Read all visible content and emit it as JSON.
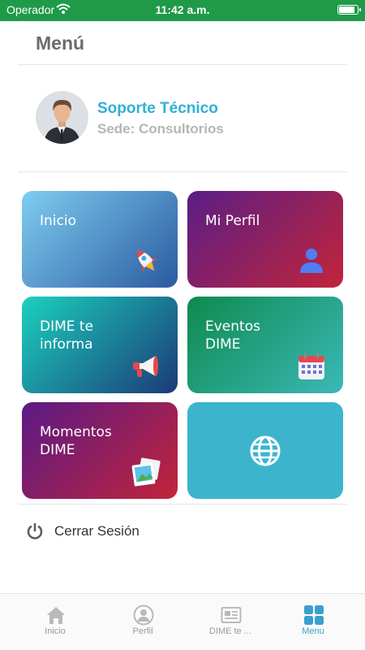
{
  "status_bar": {
    "carrier": "Operador",
    "time": "11:42 a.m.",
    "battery_level": 0.95
  },
  "header": {
    "title": "Menú"
  },
  "profile": {
    "name": "Soporte Técnico",
    "sede": "Sede: Consultorios"
  },
  "tiles": [
    {
      "label": "Inicio",
      "icon": "rocket-icon"
    },
    {
      "label": "Mi Perfil",
      "icon": "user-icon"
    },
    {
      "label": "DIME te\ninforma",
      "icon": "megaphone-icon"
    },
    {
      "label": "Eventos\nDIME",
      "icon": "calendar-icon"
    },
    {
      "label": "Momentos\nDIME",
      "icon": "photos-icon"
    },
    {
      "label": "",
      "icon": "globe-icon"
    }
  ],
  "logout": {
    "label": "Cerrar Sesión",
    "icon": "power-icon"
  },
  "tabbar": {
    "active": "Menu",
    "tabs": [
      {
        "label": "Inicio",
        "icon": "home-icon"
      },
      {
        "label": "Perfil",
        "icon": "profile-icon"
      },
      {
        "label": "DIME te ...",
        "icon": "newspaper-icon"
      },
      {
        "label": "Menu",
        "icon": "grid-icon"
      }
    ]
  },
  "colors": {
    "status_bar": "#1e9a48",
    "accent": "#2fb1d6",
    "active_tab": "#3a9fd0",
    "web_tile": "#3cb5cc"
  }
}
